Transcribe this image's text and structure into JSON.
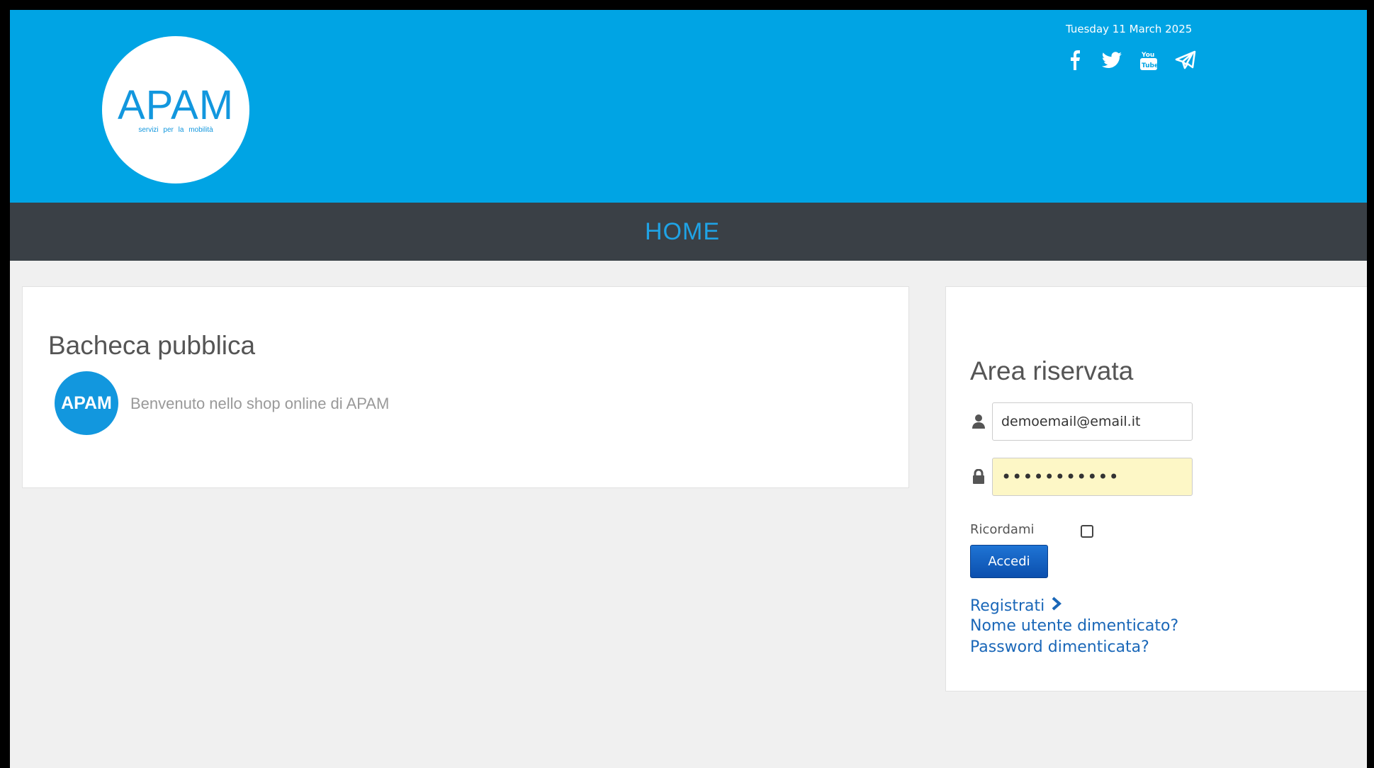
{
  "header": {
    "logo": {
      "text": "APAM",
      "subtitle": "servizi per la mobilità"
    },
    "date": "Tuesday 11 March 2025",
    "social": [
      "facebook-icon",
      "twitter-icon",
      "youtube-icon",
      "telegram-icon"
    ],
    "color": "#00a4e4"
  },
  "nav": {
    "home_label": "HOME",
    "color": "#1fa3e6",
    "bar_color": "#3a4046"
  },
  "bacheca": {
    "title": "Bacheca pubblica",
    "avatar_text": "APAM",
    "post_text": "Benvenuto nello shop online di APAM"
  },
  "login": {
    "title": "Area riservata",
    "email_value": "demoemail@email.it",
    "password_value": "•••••••••••",
    "remember_label": "Ricordami",
    "remember_checked": false,
    "submit_label": "Accedi",
    "register_label": "Registrati",
    "forgot_username_label": "Nome utente dimenticato?",
    "forgot_password_label": "Password dimenticata?"
  }
}
